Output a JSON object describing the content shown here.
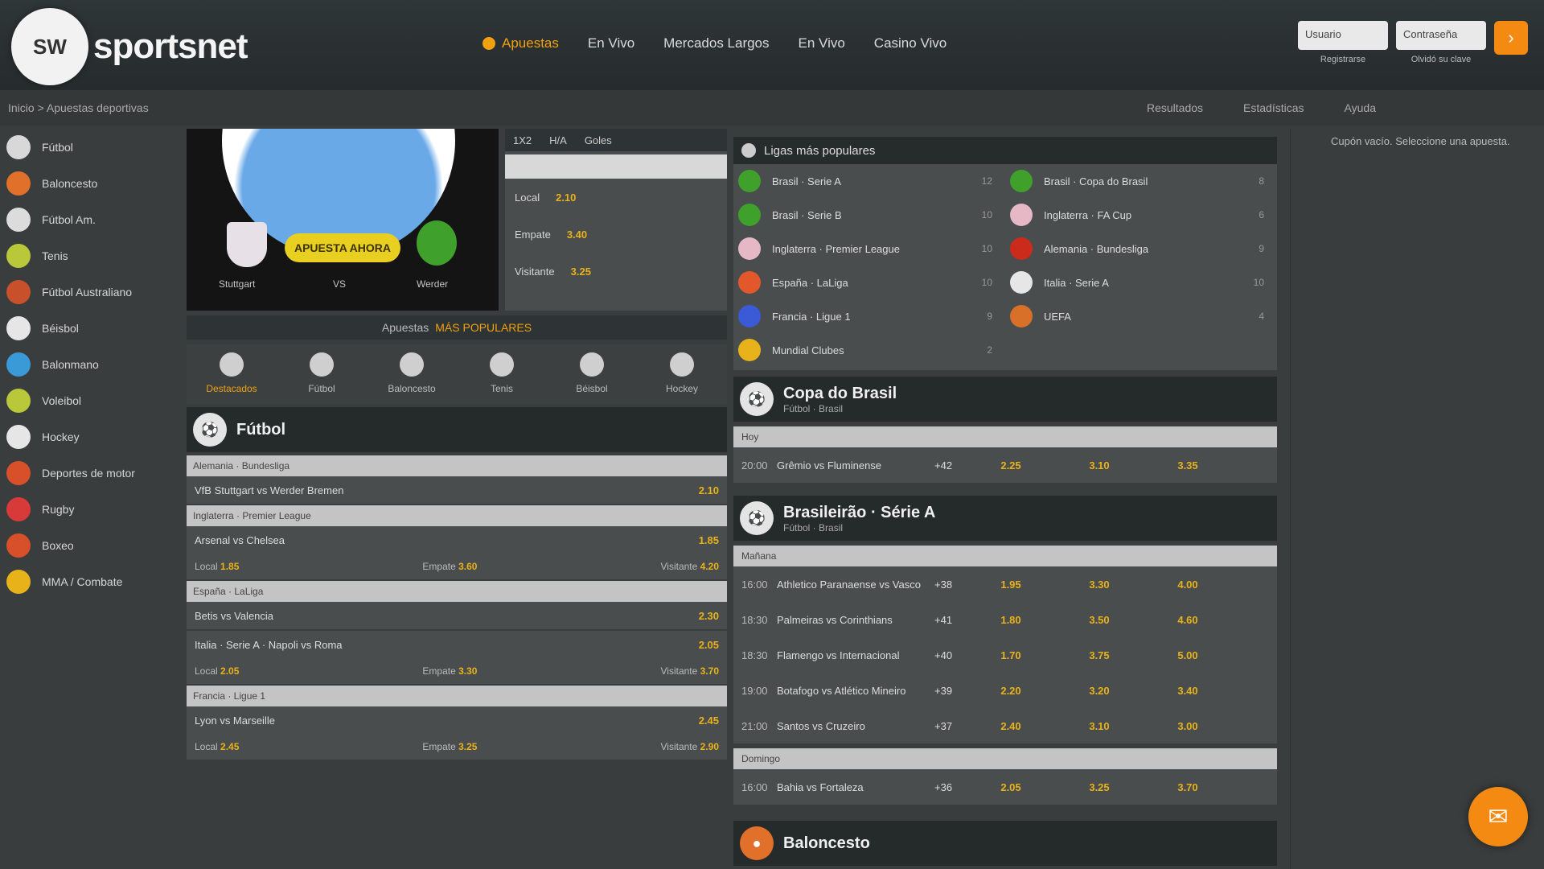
{
  "header": {
    "logo_badge": "SW",
    "logo_text": "sportsnet",
    "nav": [
      "Apuestas",
      "En Vivo",
      "Mercados Largos",
      "En Vivo",
      "Casino Vivo"
    ],
    "login": {
      "user_placeholder": "Usuario",
      "pass_placeholder": "Contraseña",
      "user_sub": "Registrarse",
      "pass_sub": "Olvidó su clave",
      "btn": "›"
    }
  },
  "subbar": {
    "breadcrumb": "Inicio > Apuestas deportivas",
    "links": [
      "Resultados",
      "Estadísticas",
      "Ayuda"
    ]
  },
  "sidebar": {
    "items": [
      {
        "label": "Fútbol",
        "color": "#d8d8d8"
      },
      {
        "label": "Baloncesto",
        "color": "#e0702a"
      },
      {
        "label": "Fútbol Am.",
        "color": "#dcdcdc"
      },
      {
        "label": "Tenis",
        "color": "#b8c83a"
      },
      {
        "label": "Fútbol Australiano",
        "color": "#c8502a"
      },
      {
        "label": "Béisbol",
        "color": "#e6e6e6"
      },
      {
        "label": "Balonmano",
        "color": "#3a9ad8"
      },
      {
        "label": "Voleibol",
        "color": "#b8c83a"
      },
      {
        "label": "Hockey",
        "color": "#e6e6e6"
      },
      {
        "label": "Deportes de motor",
        "color": "#d8502a"
      },
      {
        "label": "Rugby",
        "color": "#d83a3a"
      },
      {
        "label": "Boxeo",
        "color": "#d8502a"
      },
      {
        "label": "MMA / Combate",
        "color": "#e8b21a"
      }
    ]
  },
  "banner": {
    "cta": "APUESTA AHORA",
    "team1": "Stuttgart",
    "vs": "VS",
    "team2": "Werder"
  },
  "quick_odds": {
    "tabs": [
      "1X2",
      "H/A",
      "Goles"
    ],
    "rows": [
      {
        "label": "Local",
        "odd": "2.10"
      },
      {
        "label": "Empate",
        "odd": "3.40"
      },
      {
        "label": "Visitante",
        "odd": "3.25"
      }
    ]
  },
  "promo": {
    "text": "Apuestas",
    "highlight": "MÁS POPULARES"
  },
  "sport_tabs": [
    "Destacados",
    "Fútbol",
    "Baloncesto",
    "Tenis",
    "Béisbol",
    "Hockey"
  ],
  "left_section": {
    "title": "Fútbol"
  },
  "left_events": [
    {
      "head": "Alemania · Bundesliga",
      "name": "VfB Stuttgart vs Werder Bremen",
      "odd": "2.10",
      "odds": []
    },
    {
      "head": "Inglaterra · Premier League",
      "name": "Arsenal vs Chelsea",
      "odd": "1.85",
      "odds": [
        {
          "label": "Local",
          "v": "1.85"
        },
        {
          "label": "Empate",
          "v": "3.60"
        },
        {
          "label": "Visitante",
          "v": "4.20"
        }
      ]
    },
    {
      "head": "España · LaLiga",
      "name": "Betis vs Valencia",
      "odd": "2.30",
      "odds": []
    },
    {
      "head": "",
      "name": "Italia · Serie A · Napoli vs Roma",
      "odd": "2.05",
      "odds": [
        {
          "label": "Local",
          "v": "2.05"
        },
        {
          "label": "Empate",
          "v": "3.30"
        },
        {
          "label": "Visitante",
          "v": "3.70"
        }
      ]
    },
    {
      "head": "Francia · Ligue 1",
      "name": "Lyon vs Marseille",
      "odd": "2.45",
      "odds": [
        {
          "label": "Local",
          "v": "2.45"
        },
        {
          "label": "Empate",
          "v": "3.25"
        },
        {
          "label": "Visitante",
          "v": "2.90"
        }
      ]
    }
  ],
  "leagues": {
    "title": "Ligas más populares",
    "items": [
      {
        "name": "Brasil · Serie A",
        "count": "12",
        "color": "#3fa02b"
      },
      {
        "name": "Brasil · Copa do Brasil",
        "count": "8",
        "color": "#3fa02b"
      },
      {
        "name": "Brasil · Serie B",
        "count": "10",
        "color": "#3fa02b"
      },
      {
        "name": "Inglaterra · FA Cup",
        "count": "6",
        "color": "#e6b8c6"
      },
      {
        "name": "Inglaterra · Premier League",
        "count": "10",
        "color": "#e6b8c6"
      },
      {
        "name": "Alemania · Bundesliga",
        "count": "9",
        "color": "#cc2a1a"
      },
      {
        "name": "España · LaLiga",
        "count": "10",
        "color": "#e2582a"
      },
      {
        "name": "Italia · Serie A",
        "count": "10",
        "color": "#e6e6e6"
      },
      {
        "name": "Francia · Ligue 1",
        "count": "9",
        "color": "#3a5ad8"
      },
      {
        "name": "UEFA",
        "count": "4",
        "color": "#d8702a"
      },
      {
        "name": "Mundial Clubes",
        "count": "2",
        "color": "#e8b21a"
      }
    ]
  },
  "right_section_1": {
    "title": "Copa do Brasil",
    "sub": "Fútbol · Brasil",
    "group": "Hoy",
    "rows": [
      {
        "time": "20:00",
        "match": "Grêmio vs Fluminense",
        "mk": "+42",
        "o1": "2.25",
        "o2": "3.10",
        "o3": "3.35"
      }
    ]
  },
  "right_section_2": {
    "title": "Brasileirão · Série A",
    "sub": "Fútbol · Brasil",
    "group": "Mañana",
    "group2": "Domingo",
    "rows": [
      {
        "time": "16:00",
        "match": "Athletico Paranaense vs Vasco",
        "mk": "+38",
        "o1": "1.95",
        "o2": "3.30",
        "o3": "4.00"
      },
      {
        "time": "18:30",
        "match": "Palmeiras vs Corinthians",
        "mk": "+41",
        "o1": "1.80",
        "o2": "3.50",
        "o3": "4.60"
      },
      {
        "time": "18:30",
        "match": "Flamengo vs Internacional",
        "mk": "+40",
        "o1": "1.70",
        "o2": "3.75",
        "o3": "5.00"
      },
      {
        "time": "19:00",
        "match": "Botafogo vs Atlético Mineiro",
        "mk": "+39",
        "o1": "2.20",
        "o2": "3.20",
        "o3": "3.40"
      },
      {
        "time": "21:00",
        "match": "Santos vs Cruzeiro",
        "mk": "+37",
        "o1": "2.40",
        "o2": "3.10",
        "o3": "3.00"
      }
    ],
    "rows2": [
      {
        "time": "16:00",
        "match": "Bahia vs Fortaleza",
        "mk": "+36",
        "o1": "2.05",
        "o2": "3.25",
        "o3": "3.70"
      }
    ]
  },
  "right_section_3": {
    "title": "Baloncesto"
  },
  "betslip": {
    "empty": "Cupón vacío. Seleccione una apuesta."
  }
}
